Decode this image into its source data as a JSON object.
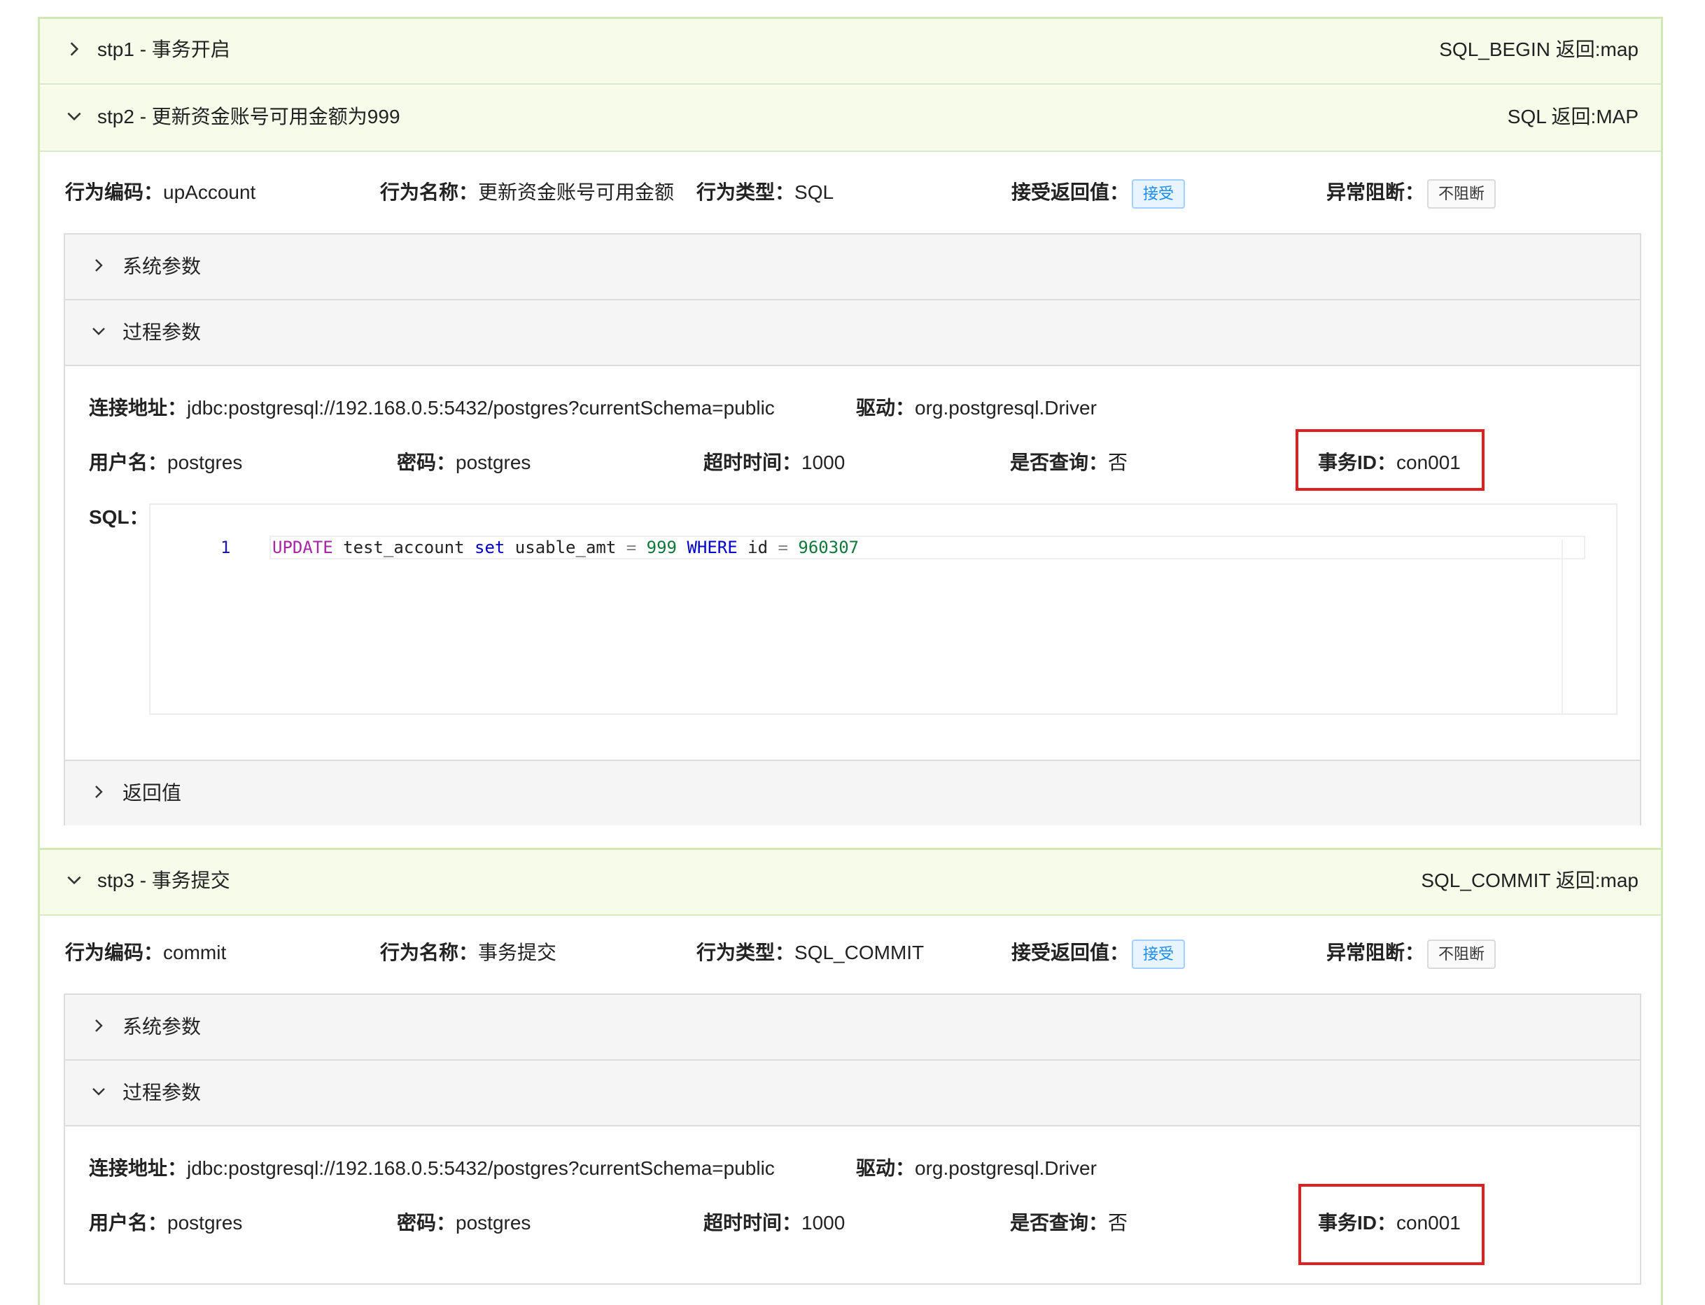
{
  "steps": [
    {
      "title": "stp1 - 事务开启",
      "ret": "SQL_BEGIN 返回:map"
    },
    {
      "title": "stp2 - 更新资金账号可用金额为999",
      "ret": "SQL 返回:MAP",
      "info": {
        "code_label": "行为编码：",
        "code_value": "upAccount",
        "name_label": "行为名称：",
        "name_value": "更新资金账号可用金额",
        "type_label": "行为类型：",
        "type_value": "SQL",
        "accept_label": "接受返回值：",
        "accept_tag": "接受",
        "block_label": "异常阻断：",
        "block_tag": "不阻断"
      },
      "sys_title": "系统参数",
      "proc_title": "过程参数",
      "proc": {
        "url_label": "连接地址：",
        "url_value": "jdbc:postgresql://192.168.0.5:5432/postgres?currentSchema=public",
        "driver_label": "驱动：",
        "driver_value": "org.postgresql.Driver",
        "user_label": "用户名：",
        "user_value": "postgres",
        "pwd_label": "密码：",
        "pwd_value": "postgres",
        "timeout_label": "超时时间：",
        "timeout_value": "1000",
        "query_label": "是否查询：",
        "query_value": "否",
        "txid_label": "事务ID：",
        "txid_value": "con001",
        "sql_label": "SQL："
      },
      "sql": {
        "line": "1",
        "kw_update": "UPDATE",
        "table": " test_account ",
        "kw_set": "set",
        "col": " usable_amt ",
        "eq1": "=",
        "num1": " 999 ",
        "kw_where": "WHERE",
        "col2": " id ",
        "eq2": "=",
        "num2": " 960307"
      },
      "ret_title": "返回值"
    },
    {
      "title": "stp3 - 事务提交",
      "ret": "SQL_COMMIT 返回:map",
      "info": {
        "code_label": "行为编码：",
        "code_value": "commit",
        "name_label": "行为名称：",
        "name_value": "事务提交",
        "type_label": "行为类型：",
        "type_value": "SQL_COMMIT",
        "accept_label": "接受返回值：",
        "accept_tag": "接受",
        "block_label": "异常阻断：",
        "block_tag": "不阻断"
      },
      "sys_title": "系统参数",
      "proc_title": "过程参数",
      "proc": {
        "url_label": "连接地址：",
        "url_value": "jdbc:postgresql://192.168.0.5:5432/postgres?currentSchema=public",
        "driver_label": "驱动：",
        "driver_value": "org.postgresql.Driver",
        "user_label": "用户名：",
        "user_value": "postgres",
        "pwd_label": "密码：",
        "pwd_value": "postgres",
        "timeout_label": "超时时间：",
        "timeout_value": "1000",
        "query_label": "是否查询：",
        "query_value": "否",
        "txid_label": "事务ID：",
        "txid_value": "con001"
      }
    }
  ],
  "icons": {
    "collapsed": "chevron-right-icon",
    "expanded": "chevron-down-icon"
  },
  "colors": {
    "step_header_bg": "#f6fbea",
    "step_border": "#cfe8b4",
    "accept_tag": "#1b8cf2",
    "highlight": "#e02020"
  }
}
